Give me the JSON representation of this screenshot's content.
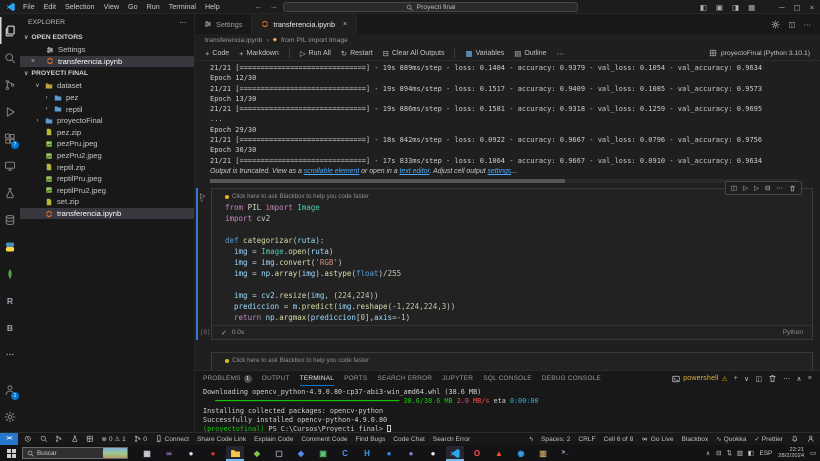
{
  "titlebar": {
    "menus": [
      "File",
      "Edit",
      "Selection",
      "View",
      "Go",
      "Run",
      "Terminal",
      "Help"
    ],
    "nav_back": "←",
    "nav_forward": "→",
    "command_center": "Proyecti final",
    "layout_icons": [
      {
        "name": "toggle-primary-sidebar",
        "glyph": "◧"
      },
      {
        "name": "toggle-panel",
        "glyph": "▣"
      },
      {
        "name": "toggle-secondary-sidebar",
        "glyph": "◨"
      },
      {
        "name": "customize-layout",
        "glyph": "▦"
      }
    ],
    "window_buttons": [
      {
        "name": "minimize",
        "glyph": "─"
      },
      {
        "name": "maximize",
        "glyph": "▢"
      },
      {
        "name": "close",
        "glyph": "×"
      }
    ]
  },
  "activity_bar": {
    "top": [
      {
        "name": "explorer",
        "icon": "files",
        "active": true
      },
      {
        "name": "search",
        "icon": "search"
      },
      {
        "name": "source-control",
        "icon": "scm"
      },
      {
        "name": "run-debug",
        "icon": "debug"
      },
      {
        "name": "extensions",
        "icon": "ext",
        "badge": "7"
      },
      {
        "name": "remote-explorer",
        "icon": "remote"
      },
      {
        "name": "testing",
        "icon": "flask"
      },
      {
        "name": "database",
        "icon": "db"
      },
      {
        "name": "python",
        "icon": "python"
      },
      {
        "name": "mongodb",
        "icon": "mongo"
      },
      {
        "name": "r-language",
        "letter": "R"
      },
      {
        "name": "blackbox",
        "letter": "B"
      },
      {
        "name": "more-views",
        "letter": "⋯"
      }
    ],
    "bottom": [
      {
        "name": "accounts",
        "icon": "person",
        "badge": "1"
      },
      {
        "name": "settings",
        "icon": "gear"
      }
    ]
  },
  "sidebar": {
    "title": "EXPLORER",
    "more_actions": "⋯",
    "open_editors_header": "OPEN EDITORS",
    "open_editors": [
      {
        "label": "Settings",
        "icon": "sliders"
      },
      {
        "label": "transferencia.ipynb",
        "icon": "jupyter",
        "active": true,
        "close": "×"
      }
    ],
    "project_header": "PROYECTI FINAL",
    "tree": [
      {
        "label": "dataset",
        "icon": "folder-open",
        "chevron": "∨",
        "indent": 0
      },
      {
        "label": "pez",
        "icon": "folder",
        "chevron": "›",
        "indent": 1
      },
      {
        "label": "reptil",
        "icon": "folder",
        "chevron": "›",
        "indent": 1
      },
      {
        "label": "proyectoFinal",
        "icon": "folder",
        "chevron": "›",
        "indent": 0
      },
      {
        "label": "pez.zip",
        "icon": "zip",
        "indent": 0
      },
      {
        "label": "pezPru.jpeg",
        "icon": "image",
        "indent": 0
      },
      {
        "label": "pezPru2.jpeg",
        "icon": "image",
        "indent": 0
      },
      {
        "label": "reptil.zip",
        "icon": "zip",
        "indent": 0
      },
      {
        "label": "reptilPru.jpeg",
        "icon": "image",
        "indent": 0
      },
      {
        "label": "reptilPru2.jpeg",
        "icon": "image",
        "indent": 0
      },
      {
        "label": "set.zip",
        "icon": "zip",
        "indent": 0
      },
      {
        "label": "transferencia.ipynb",
        "icon": "jupyter",
        "indent": 0,
        "selected": true
      }
    ]
  },
  "editor": {
    "tabs": [
      {
        "label": "Settings",
        "icon": "sliders",
        "active": false
      },
      {
        "label": "transferencia.ipynb",
        "icon": "jupyter",
        "active": true,
        "close": "×"
      }
    ],
    "tab_actions": [
      {
        "name": "configure",
        "icon": "gear"
      },
      {
        "name": "split-editor",
        "glyph": "◫"
      },
      {
        "name": "more-actions",
        "glyph": "⋯"
      }
    ],
    "breadcrumb": {
      "file": "transferencia.ipynb",
      "separator": "›",
      "cell_icon": "◆",
      "cell": "from PIL import Image"
    },
    "toolbar": {
      "items": [
        {
          "name": "add-code",
          "glyph": "+",
          "label": "Code"
        },
        {
          "name": "add-markdown",
          "glyph": "+",
          "label": "Markdown",
          "divider_after": true
        },
        {
          "name": "run-all",
          "glyph": "▷",
          "label": "Run All"
        },
        {
          "name": "restart",
          "glyph": "↻",
          "label": "Restart"
        },
        {
          "name": "clear-all-outputs",
          "glyph": "⊟",
          "label": "Clear All Outputs",
          "divider_after": true
        },
        {
          "name": "variables",
          "glyph": "▦",
          "label": "Variables",
          "blue": true
        },
        {
          "name": "outline",
          "glyph": "▤",
          "label": "Outline"
        },
        {
          "name": "more",
          "glyph": "⋯",
          "label": ""
        }
      ],
      "kernel": "proyectoFinal (Python 3.10.1)"
    }
  },
  "notebook": {
    "output_lines": [
      "21/21 [==============================] - 19s 889ms/step - loss: 0.1404 - accuracy: 0.9379 - val_loss: 0.1054 - val_accuracy: 0.9634",
      "Epoch 12/30",
      "21/21 [==============================] - 19s 894ms/step - loss: 0.1517 - accuracy: 0.9409 - val_loss: 0.1085 - val_accuracy: 0.9573",
      "Epoch 13/30",
      "21/21 [==============================] - 19s 886ms/step - loss: 0.1581 - accuracy: 0.9318 - val_loss: 0.1259 - val_accuracy: 0.9695",
      "...",
      "Epoch 29/30",
      "21/21 [==============================] - 18s 842ms/step - loss: 0.0922 - accuracy: 0.9667 - val_loss: 0.0796 - val_accuracy: 0.9756",
      "Epoch 30/30",
      "21/21 [==============================] - 17s 833ms/step - loss: 0.1064 - accuracy: 0.9667 - val_loss: 0.0910 - val_accuracy: 0.9634"
    ],
    "truncation": {
      "t1": "Output is truncated. View as a ",
      "l1": "scrollable element",
      "t2": " or open in a ",
      "l2": "text editor",
      "t3": ". Adjust cell output ",
      "l3": "settings",
      "t4": "..."
    },
    "cell": {
      "hint": "Click here to ask Blackbox to help you code faster",
      "run_glyph": "▷",
      "run_chevron": "∨",
      "toolbar": [
        {
          "name": "edit-cell",
          "g": "◫"
        },
        {
          "name": "run-above",
          "g": "▷"
        },
        {
          "name": "run-below",
          "g": "▷"
        },
        {
          "name": "split-cell",
          "g": "⊟"
        },
        {
          "name": "more-actions",
          "g": "⋯"
        },
        {
          "name": "delete-cell",
          "svg": "trash"
        }
      ],
      "code": [
        [
          [
            "kw",
            "from"
          ],
          [
            "pl",
            " PIL "
          ],
          [
            "kw",
            "import"
          ],
          [
            "cls",
            " Image"
          ]
        ],
        [
          [
            "kw",
            "import"
          ],
          [
            "pl",
            " cv2"
          ]
        ],
        [
          [
            "pl",
            ""
          ]
        ],
        [
          [
            "def",
            "def"
          ],
          [
            "fn",
            " categorizar"
          ],
          [
            "pl",
            "("
          ],
          [
            "var",
            "ruta"
          ],
          [
            "pl",
            "):"
          ]
        ],
        [
          [
            "pl",
            "  "
          ],
          [
            "var",
            "img"
          ],
          [
            "pl",
            " = "
          ],
          [
            "cls",
            "Image"
          ],
          [
            "pl",
            "."
          ],
          [
            "fn",
            "open"
          ],
          [
            "pl",
            "("
          ],
          [
            "var",
            "ruta"
          ],
          [
            "pl",
            ")"
          ]
        ],
        [
          [
            "pl",
            "  "
          ],
          [
            "var",
            "img"
          ],
          [
            "pl",
            " = "
          ],
          [
            "var",
            "img"
          ],
          [
            "pl",
            "."
          ],
          [
            "fn",
            "convert"
          ],
          [
            "pl",
            "("
          ],
          [
            "str",
            "'RGB'"
          ],
          [
            "pl",
            ")"
          ]
        ],
        [
          [
            "pl",
            "  "
          ],
          [
            "var",
            "img"
          ],
          [
            "pl",
            " = "
          ],
          [
            "var",
            "np"
          ],
          [
            "pl",
            "."
          ],
          [
            "fn",
            "array"
          ],
          [
            "pl",
            "("
          ],
          [
            "var",
            "img"
          ],
          [
            "pl",
            ")."
          ],
          [
            "fn",
            "astype"
          ],
          [
            "pl",
            "("
          ],
          [
            "def",
            "float"
          ],
          [
            "pl",
            ")/"
          ],
          [
            "num",
            "255"
          ]
        ],
        [
          [
            "pl",
            ""
          ]
        ],
        [
          [
            "pl",
            "  "
          ],
          [
            "var",
            "img"
          ],
          [
            "pl",
            " = "
          ],
          [
            "var",
            "cv2"
          ],
          [
            "pl",
            "."
          ],
          [
            "fn",
            "resize"
          ],
          [
            "pl",
            "("
          ],
          [
            "var",
            "img"
          ],
          [
            "pl",
            ", ("
          ],
          [
            "num",
            "224"
          ],
          [
            "pl",
            ","
          ],
          [
            "num",
            "224"
          ],
          [
            "pl",
            "))"
          ]
        ],
        [
          [
            "pl",
            "  "
          ],
          [
            "var",
            "prediccion"
          ],
          [
            "pl",
            " = "
          ],
          [
            "var",
            "m"
          ],
          [
            "pl",
            "."
          ],
          [
            "fn",
            "predict"
          ],
          [
            "pl",
            "("
          ],
          [
            "var",
            "img"
          ],
          [
            "pl",
            "."
          ],
          [
            "fn",
            "reshape"
          ],
          [
            "pl",
            "("
          ],
          [
            "num",
            "-1"
          ],
          [
            "pl",
            ","
          ],
          [
            "num",
            "224"
          ],
          [
            "pl",
            ","
          ],
          [
            "num",
            "224"
          ],
          [
            "pl",
            ","
          ],
          [
            "num",
            "3"
          ],
          [
            "pl",
            "))"
          ]
        ],
        [
          [
            "pl",
            "  "
          ],
          [
            "kw",
            "return"
          ],
          [
            "pl",
            " "
          ],
          [
            "var",
            "np"
          ],
          [
            "pl",
            "."
          ],
          [
            "fn",
            "argmax"
          ],
          [
            "pl",
            "("
          ],
          [
            "var",
            "prediccion"
          ],
          [
            "pl",
            "["
          ],
          [
            "num",
            "0"
          ],
          [
            "pl",
            "],"
          ],
          [
            "var",
            "axis"
          ],
          [
            "pl",
            "="
          ],
          [
            "num",
            "-1"
          ],
          [
            "pl",
            ")"
          ]
        ]
      ],
      "exec_count": "[8]",
      "check": "✓",
      "exec_time": "0.0s",
      "language": "Python"
    },
    "next_cell_hint": "Click here to ask Blackbox to help you code faster"
  },
  "panel": {
    "tabs": [
      {
        "label": "PROBLEMS",
        "badge": "1"
      },
      {
        "label": "OUTPUT"
      },
      {
        "label": "TERMINAL",
        "active": true
      },
      {
        "label": "PORTS"
      },
      {
        "label": "SEARCH ERROR"
      },
      {
        "label": "JUPYTER"
      },
      {
        "label": "SQL CONSOLE"
      },
      {
        "label": "DEBUG CONSOLE"
      }
    ],
    "shell": {
      "label": "powershell",
      "warning": "⚠"
    },
    "actions": [
      {
        "name": "new-terminal",
        "g": "+"
      },
      {
        "name": "terminal-dropdown",
        "g": "∨"
      },
      {
        "name": "split-terminal",
        "g": "◫"
      },
      {
        "name": "kill-terminal",
        "svg": "trash"
      },
      {
        "name": "more-actions",
        "g": "⋯"
      },
      {
        "name": "maximize-panel",
        "g": "∧"
      },
      {
        "name": "close-panel",
        "g": "×"
      }
    ],
    "terminal": [
      [
        [
          "pl",
          "Downloading opencv_python-4.9.0.80-cp37-abi3-win_amd64.whl (38.6 MB)"
        ]
      ],
      [
        [
          "green",
          "   ━━━━━━━━━━━━━━━━━━━━━━━━━━━━━━━━━━━━━━━━━━━━━ "
        ],
        [
          "green",
          "38.6/38.6 MB"
        ],
        [
          "pl",
          " "
        ],
        [
          "red",
          "2.0 MB/s"
        ],
        [
          "pl",
          " eta "
        ],
        [
          "cyan",
          "0:00:00"
        ]
      ],
      [
        [
          "pl",
          "Installing collected packages: opencv-python"
        ]
      ],
      [
        [
          "pl",
          "Successfully installed opencv-python-4.9.0.80"
        ]
      ],
      [
        [
          "green",
          "(proyectofinal)"
        ],
        [
          "pl",
          " PS C:\\Cursos\\Proyecti final> "
        ],
        [
          "cursor",
          ""
        ]
      ]
    ]
  },
  "status_bar": {
    "remote_glyph": "><",
    "left": [
      {
        "name": "history",
        "svg": "clock"
      },
      {
        "name": "search-status",
        "svg": "search"
      },
      {
        "name": "branch",
        "svg": "scm"
      },
      {
        "name": "testing-status",
        "svg": "flask"
      },
      {
        "name": "table-status",
        "svg": "grid"
      },
      {
        "name": "problems",
        "text": "⊗ 0  ⚠ 1"
      },
      {
        "name": "forks",
        "svg": "scm",
        "text": "0"
      },
      {
        "name": "connect",
        "svg": "phone",
        "text": "Connect"
      },
      {
        "name": "share-code-link",
        "text": "Share Code Link"
      },
      {
        "name": "explain-code",
        "text": "Explain Code"
      },
      {
        "name": "comment-code",
        "text": "Comment Code"
      },
      {
        "name": "find-bugs",
        "text": "Find Bugs"
      },
      {
        "name": "code-chat",
        "text": "Code Chat"
      },
      {
        "name": "search-error",
        "text": "Search Error"
      }
    ],
    "right": [
      {
        "name": "lightning",
        "text": "ϟ"
      },
      {
        "name": "indentation",
        "text": "Spaces: 2"
      },
      {
        "name": "eol",
        "text": "CRLF"
      },
      {
        "name": "cell-position",
        "text": "Cell 6 of 8"
      },
      {
        "name": "go-live",
        "svg": "broadcast",
        "text": "Go Live"
      },
      {
        "name": "blackbox-status",
        "text": "Blackbox"
      },
      {
        "name": "quokka",
        "text": "∿ Quokka"
      },
      {
        "name": "prettier",
        "text": "✓ Prettier"
      },
      {
        "name": "notifications",
        "svg": "bell"
      },
      {
        "name": "accessibility",
        "svg": "person"
      }
    ]
  },
  "taskbar": {
    "search_placeholder": "Buscar",
    "apps": [
      {
        "name": "task-view",
        "letter": "▦",
        "fg": "#cfd4da"
      },
      {
        "name": "visual-studio",
        "letter": "∞",
        "fg": "#b57ce8"
      },
      {
        "name": "unity",
        "letter": "●",
        "fg": "#d9dde2"
      },
      {
        "name": "opera-gx",
        "letter": "●",
        "fg": "#e03131"
      },
      {
        "name": "file-explorer",
        "svg": "folder-yellow",
        "active": true
      },
      {
        "name": "app-green",
        "letter": "◆",
        "fg": "#7ac943"
      },
      {
        "name": "app-window",
        "letter": "▢",
        "fg": "#aab2bd"
      },
      {
        "name": "app-blue-diamond",
        "letter": "◆",
        "fg": "#4f8ef7"
      },
      {
        "name": "app-green-box",
        "letter": "▣",
        "fg": "#58c470"
      },
      {
        "name": "app-c",
        "letter": "C",
        "fg": "#4f8ef7"
      },
      {
        "name": "app-h",
        "letter": "H",
        "fg": "#3aa0e8"
      },
      {
        "name": "app-blue-circle",
        "letter": "●",
        "fg": "#2f8de4"
      },
      {
        "name": "github-desktop",
        "letter": "●",
        "fg": "#9a6fe0"
      },
      {
        "name": "app-white-circle",
        "letter": "●",
        "fg": "#e8eaed"
      },
      {
        "name": "vscode",
        "svg": "vscode",
        "active": true
      },
      {
        "name": "opera",
        "letter": "O",
        "fg": "#ff4b4b"
      },
      {
        "name": "brave",
        "letter": "▲",
        "fg": "#fb542b"
      },
      {
        "name": "app-eye",
        "letter": "◉",
        "fg": "#35a0e8"
      },
      {
        "name": "calibre",
        "letter": "▥",
        "fg": "#c9a15f"
      },
      {
        "name": "windows-terminal",
        "letter": ">_",
        "fg": "#cfd4da"
      }
    ],
    "tray": {
      "chevron": "∧",
      "icons": [
        {
          "name": "tray-device",
          "g": "⊟"
        },
        {
          "name": "tray-sync",
          "g": "⇅"
        },
        {
          "name": "tray-network",
          "g": "▥"
        },
        {
          "name": "tray-volume",
          "g": "◧"
        }
      ],
      "lang": "ESP",
      "time": "22:21",
      "date": "28/2/2024",
      "action_center": "▭"
    }
  },
  "colors": {
    "accent": "#0078d4",
    "cell_focus": "#3778d0",
    "powershell_label": "#d8b24a",
    "link": "#4daafc"
  }
}
